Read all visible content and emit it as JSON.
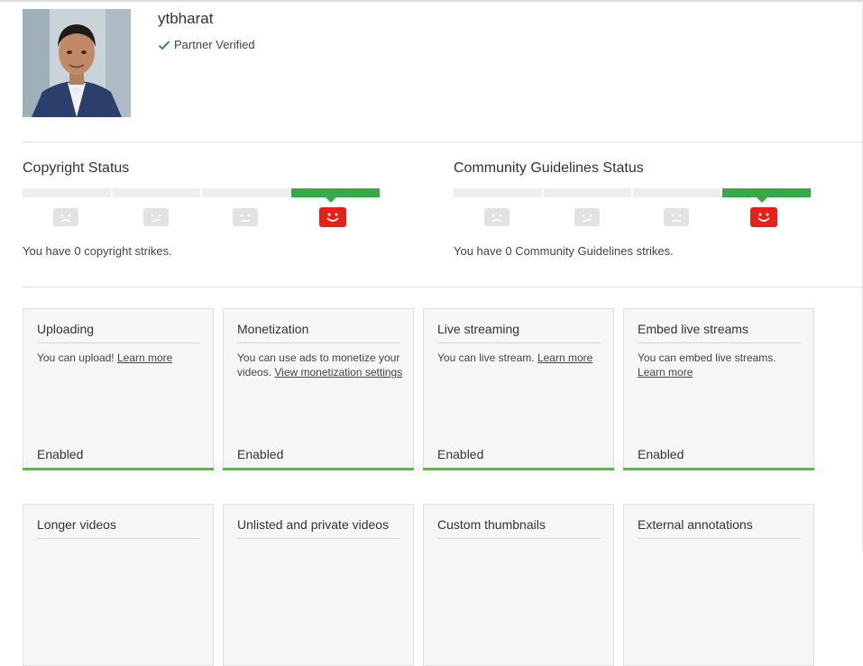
{
  "channel": {
    "name": "ytbharat",
    "verified_label": "Partner Verified"
  },
  "copyright": {
    "title": "Copyright Status",
    "strikes_text": "You have 0 copyright strikes.",
    "active_level": 4,
    "levels": 4
  },
  "community": {
    "title": "Community Guidelines Status",
    "strikes_text": "You have 0 Community Guidelines strikes.",
    "active_level": 4,
    "levels": 4
  },
  "colors": {
    "active_bar": "#39a846",
    "happy_face": "#e62117",
    "enabled_bar": "#4ac23b"
  },
  "features": [
    {
      "title": "Uploading",
      "desc_text": "You can upload! ",
      "link_text": "Learn more",
      "status": "Enabled"
    },
    {
      "title": "Monetization",
      "desc_text": "You can use ads to monetize your videos. ",
      "link_text": "View monetization settings",
      "status": "Enabled"
    },
    {
      "title": "Live streaming",
      "desc_text": "You can live stream. ",
      "link_text": "Learn more",
      "status": "Enabled"
    },
    {
      "title": "Embed live streams",
      "desc_text": "You can embed live streams. ",
      "link_text": "Learn more",
      "status": "Enabled"
    },
    {
      "title": "Longer videos"
    },
    {
      "title": "Unlisted and private videos"
    },
    {
      "title": "Custom thumbnails"
    },
    {
      "title": "External annotations"
    }
  ]
}
